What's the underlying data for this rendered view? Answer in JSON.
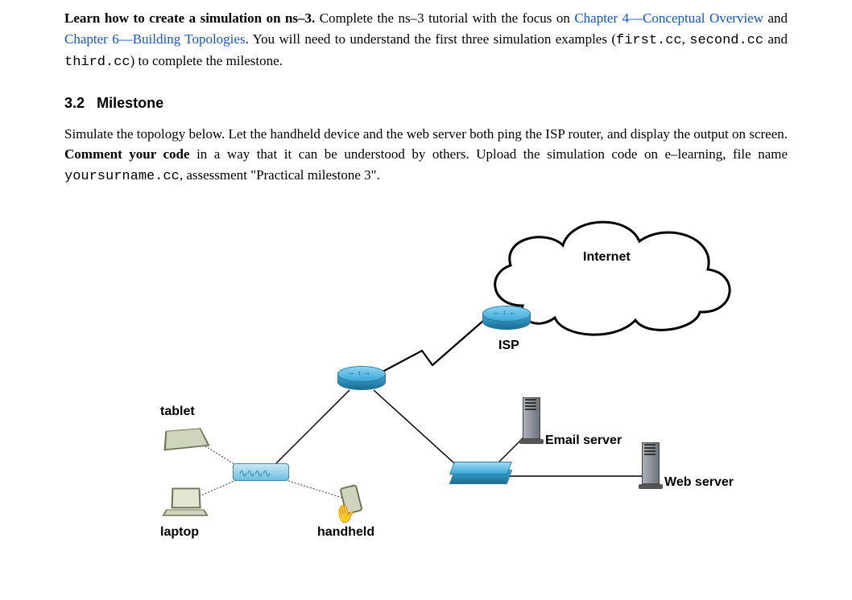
{
  "intro": {
    "lead_bold": "Learn how to create a simulation on ns–3.",
    "after_lead": " Complete the ns–3 tutorial with the focus on ",
    "link1": "Chapter 4—Conceptual Overview",
    "between_links": "  and ",
    "link2": "Chapter 6—Building Topologies",
    "after_links": ". You will need to understand the first three simulation examples (",
    "code1": "first.cc",
    "sep1": ", ",
    "code2": "second.cc",
    "sep2": " and ",
    "code3": "third.cc",
    "tail": ") to complete the milestone."
  },
  "section": {
    "number": "3.2",
    "title": "Milestone"
  },
  "milestone": {
    "p1a": "Simulate the topology below.  Let the handheld device and the web server both ping the ISP router, and display the output on screen. ",
    "p1_bold": "Comment your code",
    "p1b": " in a way that it can be understood by others.  Upload the simulation code on e–learning, file name ",
    "code_file": "yoursurname.cc",
    "p1c": ", assessment \"Practical milestone 3\"."
  },
  "diagram": {
    "labels": {
      "internet": "Internet",
      "isp": "ISP",
      "tablet": "tablet",
      "laptop": "laptop",
      "handheld": "handheld",
      "email": "Email server",
      "web": "Web server"
    }
  }
}
